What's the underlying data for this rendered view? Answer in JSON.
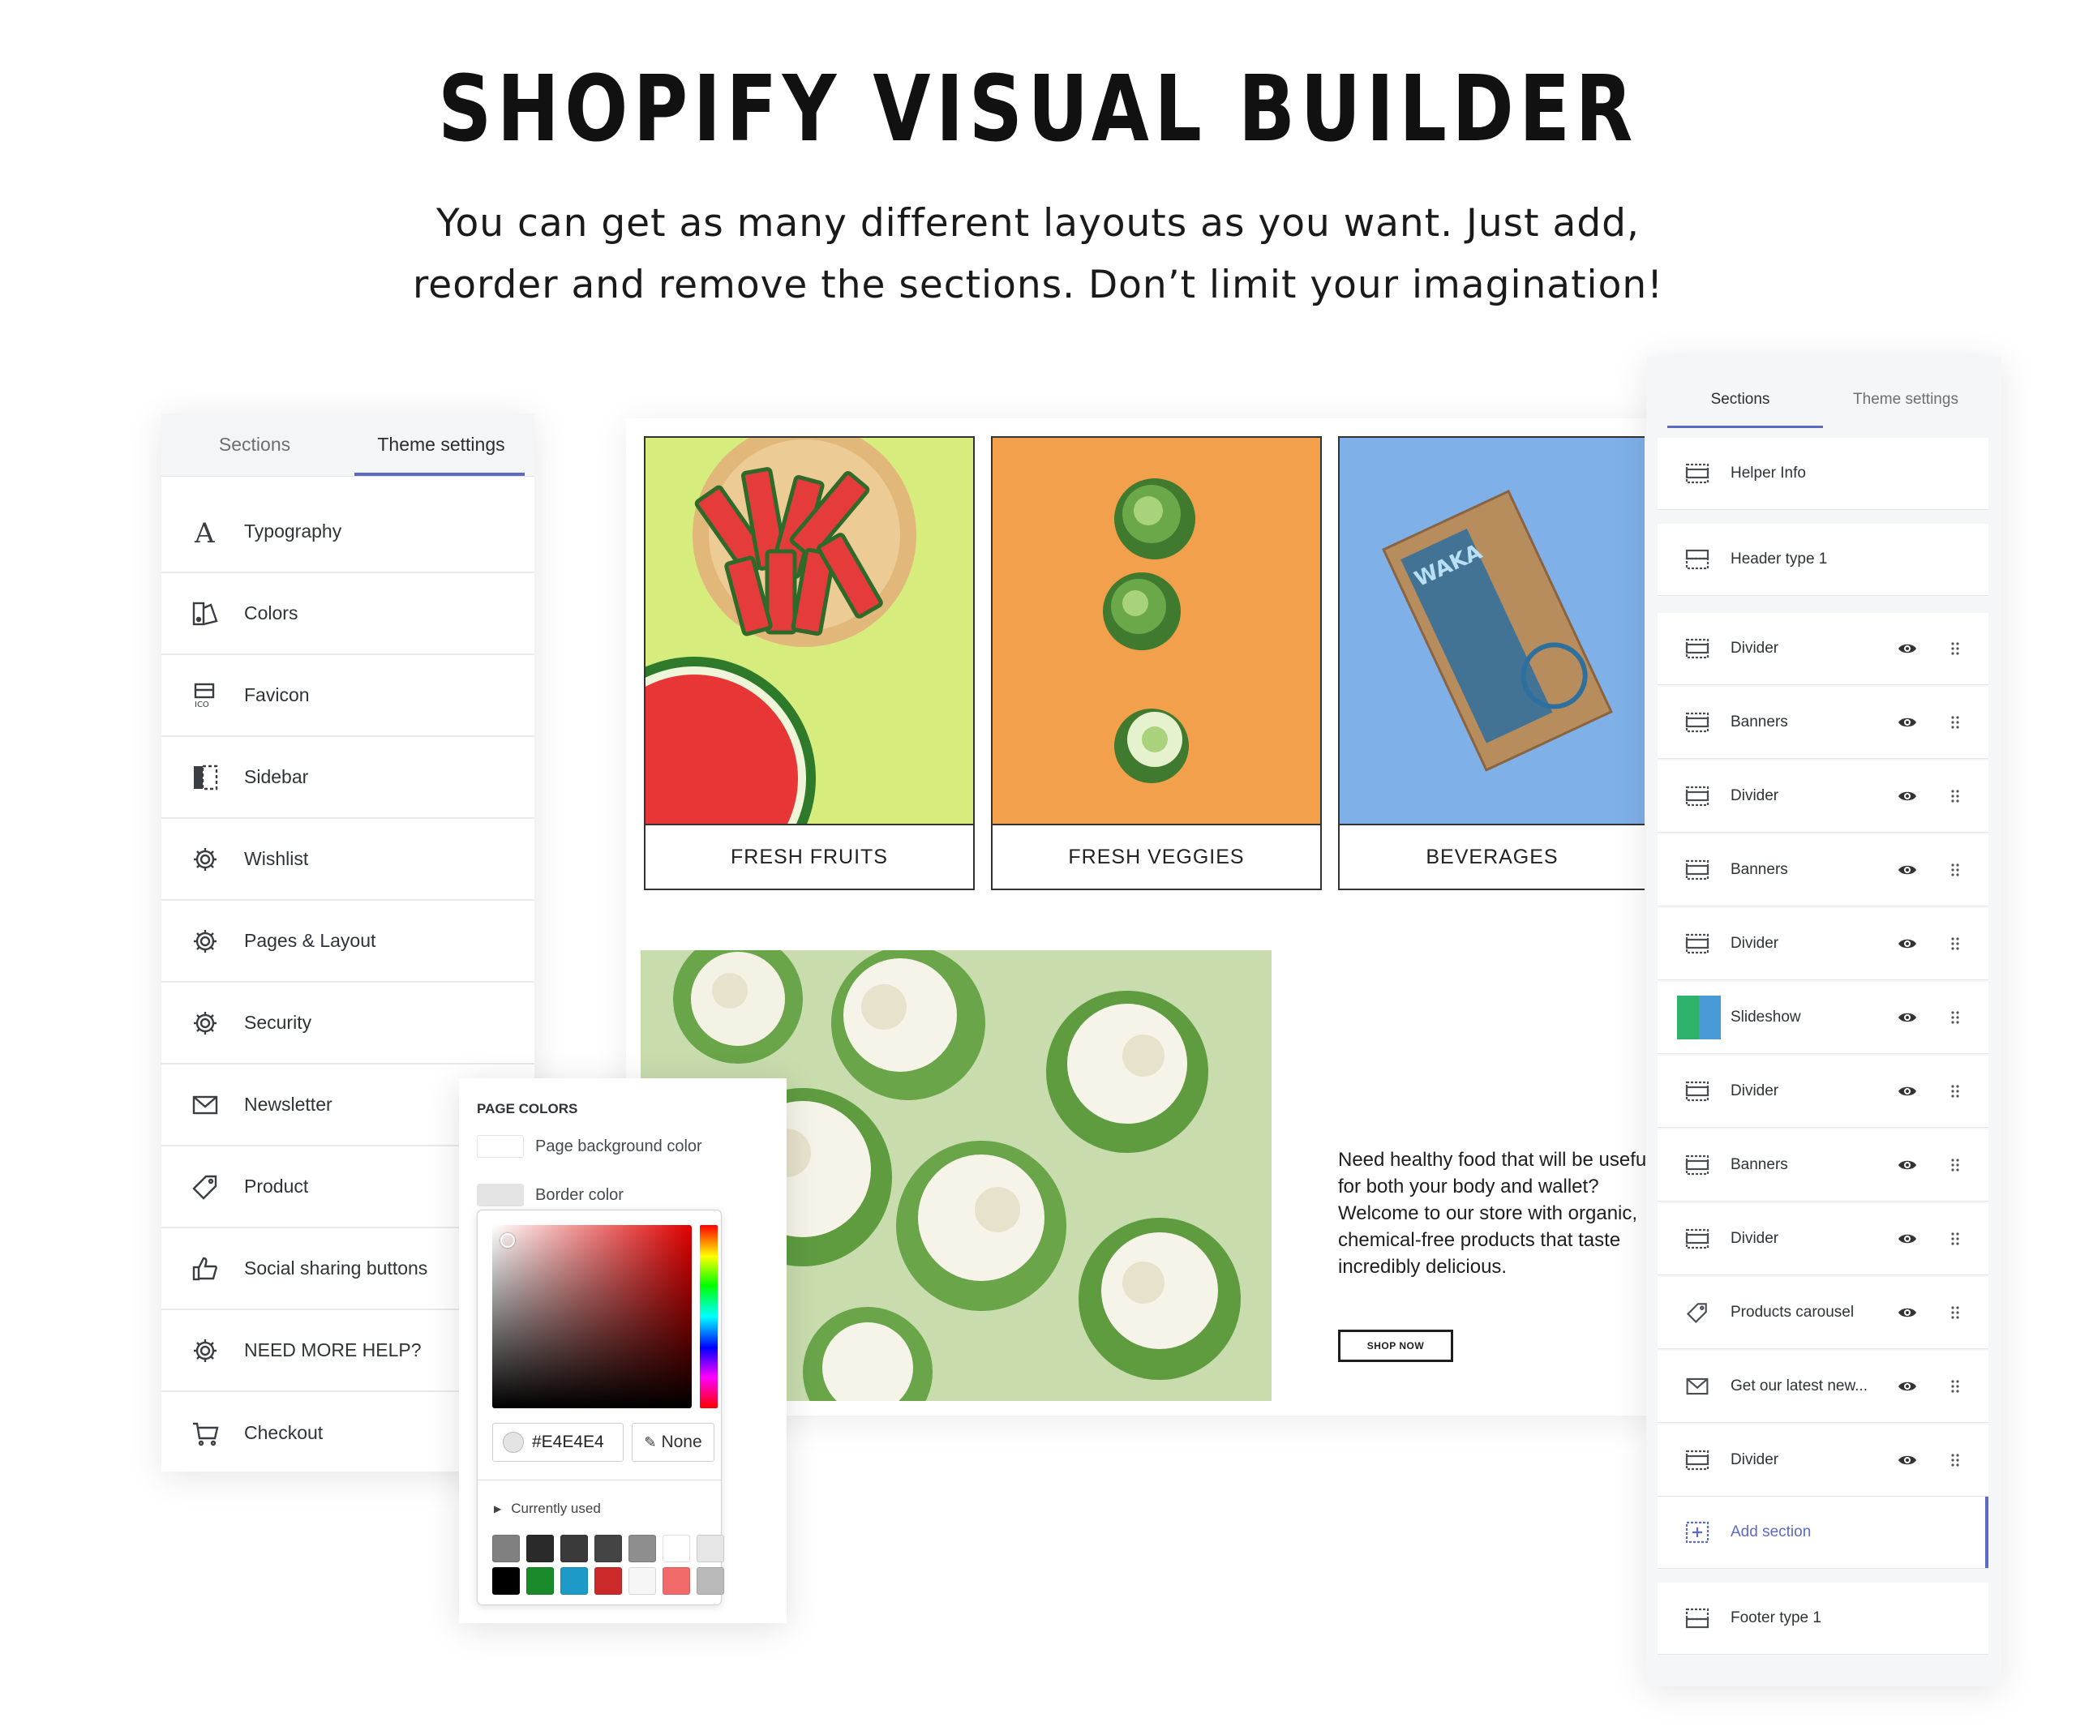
{
  "hero": {
    "title": "SHOPIFY VISUAL BUILDER",
    "subtitle_line1": "You can get as many different layouts as you want. Just add,",
    "subtitle_line2": "reorder and remove the sections. Don’t limit your imagination!"
  },
  "left_panel": {
    "tabs": [
      {
        "label": "Sections",
        "active": false
      },
      {
        "label": "Theme settings",
        "active": true
      }
    ],
    "items": [
      {
        "label": "Typography",
        "icon": "typography-icon"
      },
      {
        "label": "Colors",
        "icon": "colors-icon"
      },
      {
        "label": "Favicon",
        "icon": "favicon-icon"
      },
      {
        "label": "Sidebar",
        "icon": "sidebar-icon"
      },
      {
        "label": "Wishlist",
        "icon": "gear-icon"
      },
      {
        "label": "Pages & Layout",
        "icon": "gear-icon"
      },
      {
        "label": "Security",
        "icon": "gear-icon"
      },
      {
        "label": "Newsletter",
        "icon": "envelope-icon"
      },
      {
        "label": "Product",
        "icon": "tag-icon"
      },
      {
        "label": "Social sharing buttons",
        "icon": "thumbs-up-icon"
      },
      {
        "label": "NEED MORE HELP?",
        "icon": "gear-icon"
      },
      {
        "label": "Checkout",
        "icon": "cart-icon"
      }
    ]
  },
  "store_preview": {
    "categories": [
      {
        "label": "FRESH FRUITS",
        "bg": "#d6ed7e"
      },
      {
        "label": "FRESH VEGGIES",
        "bg": "#f2a04b"
      },
      {
        "label": "BEVERAGES",
        "bg": "#7fb0e8"
      }
    ],
    "promo_text": "Need healthy food that will be useful for both your body and wallet? Welcome to our store with organic, chemical-free products that taste incredibly delicious.",
    "shop_button": "SHOP NOW"
  },
  "color_picker": {
    "section_title": "PAGE COLORS",
    "rows": [
      {
        "label": "Page background color",
        "color": "#ffffff"
      },
      {
        "label": "Border color",
        "color": "#e4e4e4"
      }
    ],
    "hex_value": "#E4E4E4",
    "none_label": "None",
    "currently_used_label": "Currently used",
    "swatches": [
      "#808080",
      "#2a2a2a",
      "#3a3a3a",
      "#444444",
      "#8e8e8e",
      "#ffffff",
      "#e6e6e6",
      "#000000",
      "#1a8a2a",
      "#1d9ac7",
      "#cc2a2a",
      "#f6f6f6",
      "#f26a6a",
      "#b9b9b9"
    ]
  },
  "right_panel": {
    "tabs": [
      {
        "label": "Sections",
        "active": true
      },
      {
        "label": "Theme settings",
        "active": false
      }
    ],
    "items": [
      {
        "label": "Helper Info",
        "icon": "section-icon",
        "controls": false
      },
      {
        "label": "Header type 1",
        "icon": "header-icon",
        "controls": false
      },
      {
        "label": "Divider",
        "icon": "section-icon",
        "controls": true
      },
      {
        "label": "Banners",
        "icon": "section-icon",
        "controls": true
      },
      {
        "label": "Divider",
        "icon": "section-icon",
        "controls": true
      },
      {
        "label": "Banners",
        "icon": "section-icon",
        "controls": true
      },
      {
        "label": "Divider",
        "icon": "section-icon",
        "controls": true
      },
      {
        "label": "Slideshow",
        "icon": "slideshow-thumbnail",
        "controls": true
      },
      {
        "label": "Divider",
        "icon": "section-icon",
        "controls": true
      },
      {
        "label": "Banners",
        "icon": "section-icon",
        "controls": true
      },
      {
        "label": "Divider",
        "icon": "section-icon",
        "controls": true
      },
      {
        "label": "Products carousel",
        "icon": "tag-icon",
        "controls": true
      },
      {
        "label": "Get our latest new...",
        "icon": "envelope-icon",
        "controls": true
      },
      {
        "label": "Divider",
        "icon": "section-icon",
        "controls": true
      },
      {
        "label": "Add section",
        "icon": "add-section-icon",
        "controls": false
      },
      {
        "label": "Footer type 1",
        "icon": "footer-icon",
        "controls": false
      }
    ]
  },
  "colors": {
    "accent": "#5c6ac4"
  }
}
